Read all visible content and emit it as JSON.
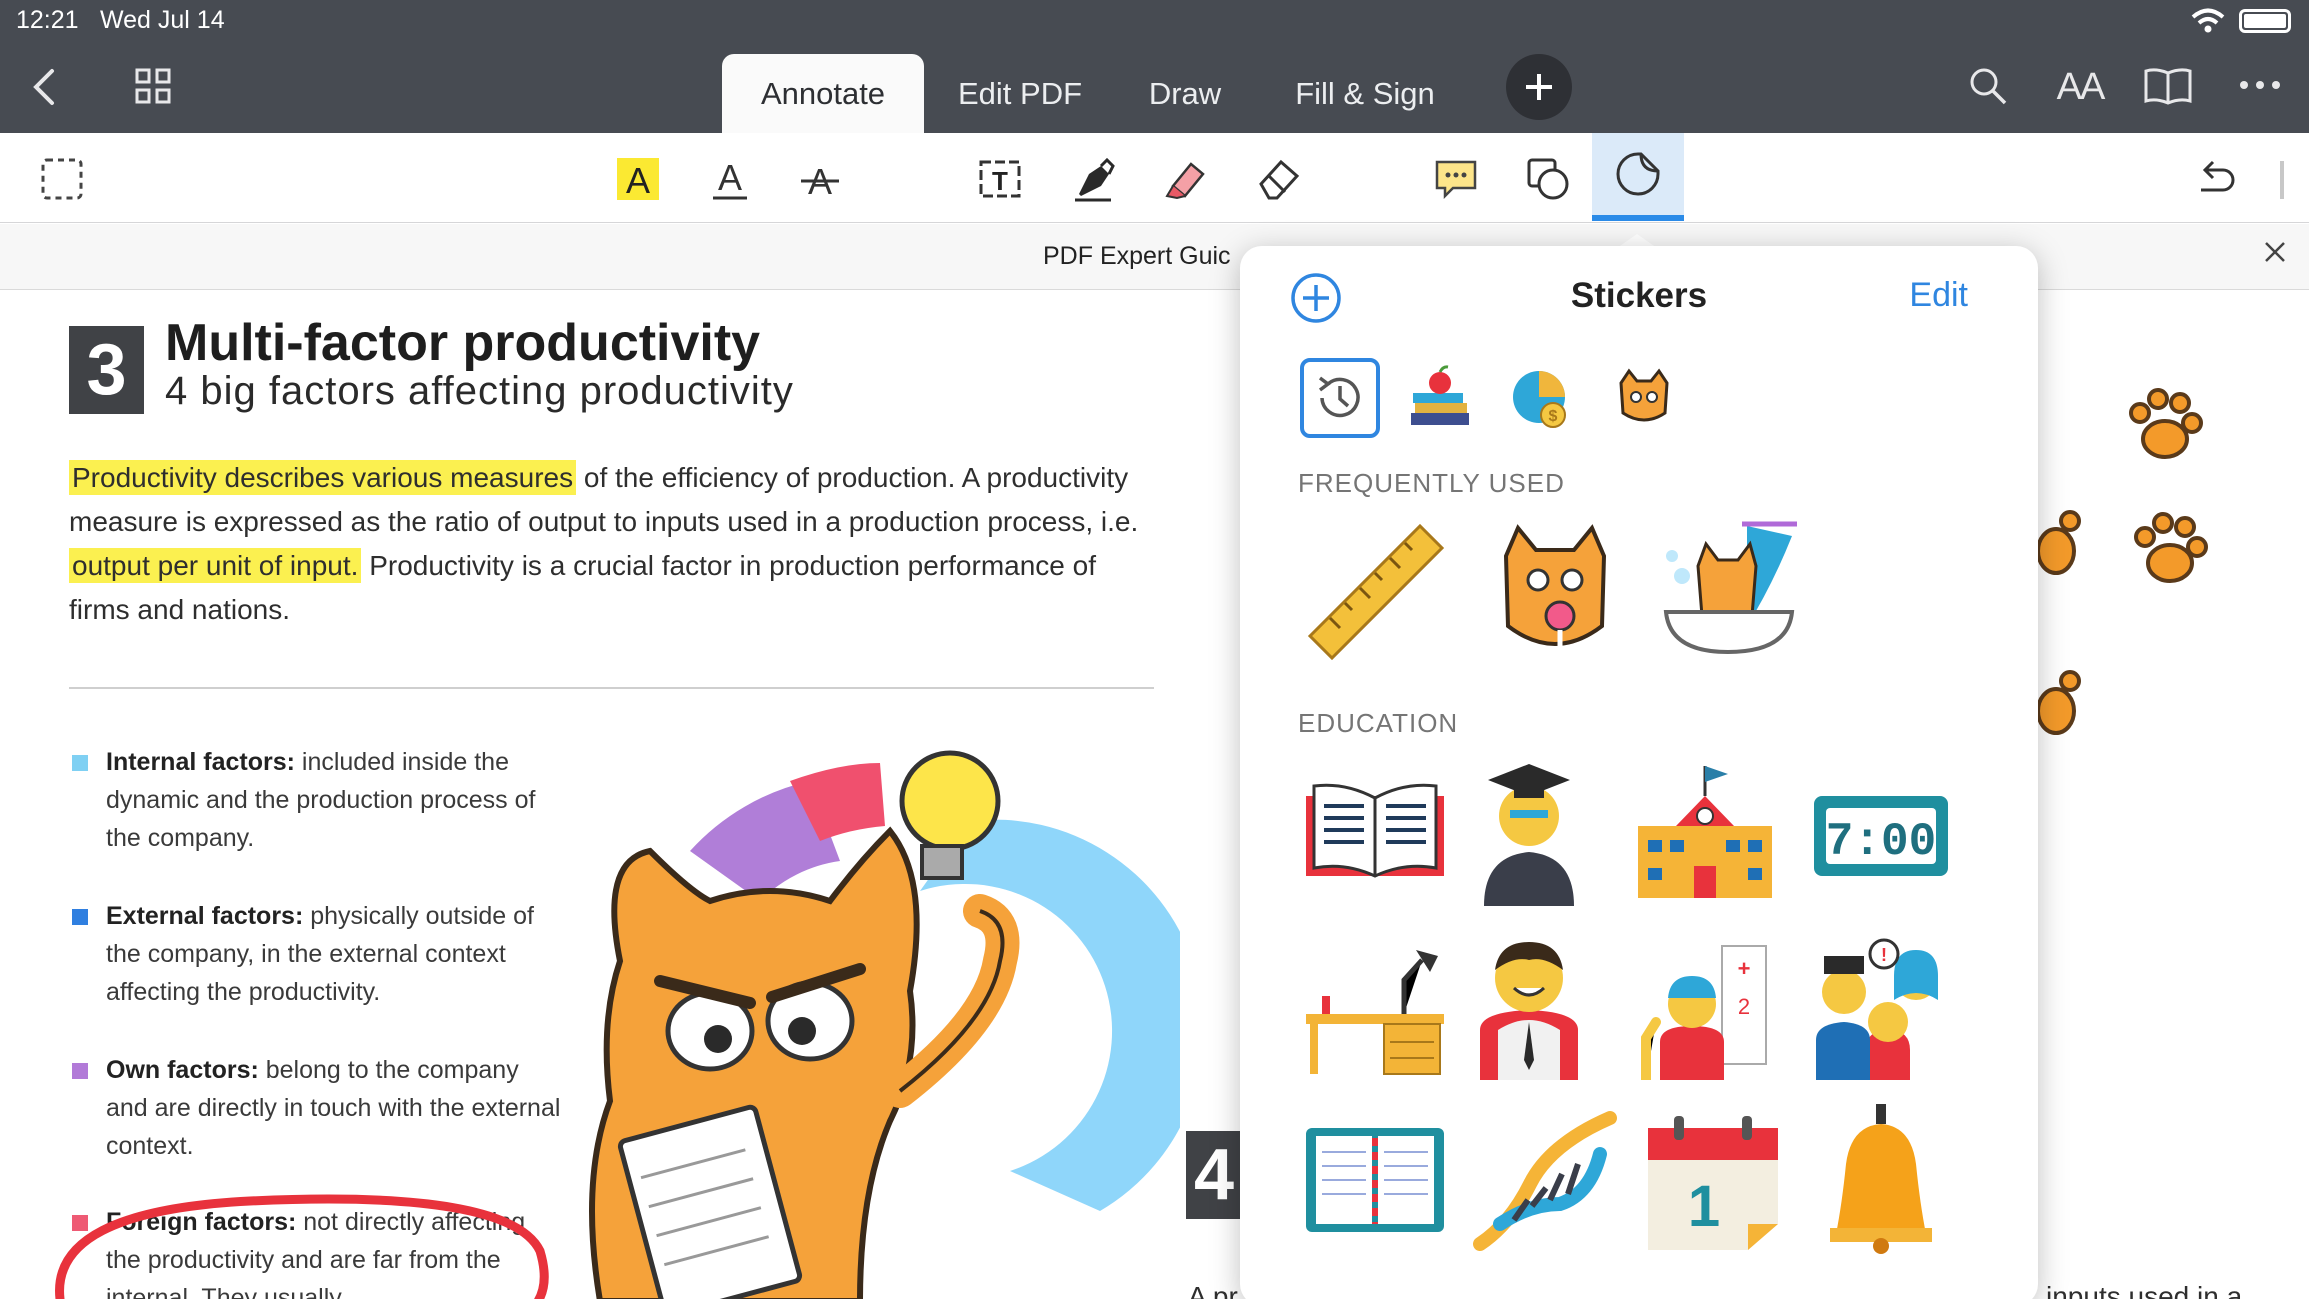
{
  "status": {
    "time": "12:21",
    "date": "Wed Jul 14"
  },
  "tabs": [
    {
      "label": "Annotate",
      "active": true
    },
    {
      "label": "Edit PDF",
      "active": false
    },
    {
      "label": "Draw",
      "active": false
    },
    {
      "label": "Fill & Sign",
      "active": false
    }
  ],
  "top_right": {
    "text_size_label": "AA"
  },
  "document": {
    "tab_title": "PDF Expert Guic",
    "section_number": "3",
    "heading": "Multi-factor productivity",
    "subheading": "4 big factors affecting productivity",
    "para_hl1": "Productivity describes various measures",
    "para_t1": " of the efficiency of production. A productivity measure is expressed as the ratio of output to inputs used in a production process, i.e. ",
    "para_hl2": "output per unit of input.",
    "para_t2": " Productivity is a crucial factor in production performance of firms and nations.",
    "bullets": [
      {
        "title": "Internal factors:",
        "text": " included inside the dynamic and the production process of the company.",
        "color": "#7fd0f3"
      },
      {
        "title": "External factors:",
        "text": " physically outside of the company, in the external context affecting the productivity.",
        "color": "#2f7fe0"
      },
      {
        "title": "Own factors:",
        "text": " belong to the company and are directly in touch with the external context.",
        "color": "#b27ad8"
      },
      {
        "title": "Foreign factors:",
        "text": " not directly affecting the productivity and are far from the internal. They usually",
        "color": "#ee5a74"
      }
    ],
    "next_section_number": "4",
    "bottom_left_text": "A pr",
    "bottom_right_text": "inputs used in a"
  },
  "stickers": {
    "title": "Stickers",
    "edit_label": "Edit",
    "sections": {
      "frequent": "FREQUENTLY USED",
      "education": "EDUCATION"
    },
    "clock_display": "7:00",
    "calendar_day": "1"
  },
  "colors": {
    "accent": "#2f86e0",
    "topbar": "#474b52",
    "highlight": "#fbf050",
    "annotation_red": "#e8323c"
  }
}
